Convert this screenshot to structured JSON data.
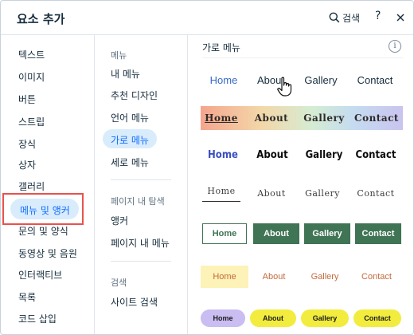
{
  "header": {
    "title": "요소 추가",
    "search_label": "검색",
    "help_label": "?"
  },
  "categories": [
    "텍스트",
    "이미지",
    "버튼",
    "스트립",
    "장식",
    "상자",
    "갤러리",
    "메뉴 및 앵커",
    "문의 및 양식",
    "동영상 및 음원",
    "인터랙티브",
    "목록",
    "코드 삽입"
  ],
  "active_category": "메뉴 및 앵커",
  "subcategories": {
    "group1_title": "메뉴",
    "group1_items": [
      "내 메뉴",
      "추천 디자인",
      "언어 메뉴",
      "가로 메뉴",
      "세로 메뉴"
    ],
    "active_item": "가로 메뉴",
    "group2_title": "페이지 내 탐색",
    "group2_items": [
      "앵커",
      "페이지 내 메뉴"
    ],
    "group3_title": "검색",
    "group3_items": [
      "사이트 검색"
    ]
  },
  "section": {
    "title": "가로 메뉴",
    "info_label": "i"
  },
  "menu_presets": [
    [
      "Home",
      "About",
      "Gallery",
      "Contact"
    ],
    [
      "Home",
      "About",
      "Gallery",
      "Contact"
    ],
    [
      "Home",
      "About",
      "Gallery",
      "Contact"
    ],
    [
      "Home",
      "About",
      "Gallery",
      "Contact"
    ],
    [
      "Home",
      "About",
      "Gallery",
      "Contact"
    ],
    [
      "Home",
      "About",
      "Gallery",
      "Contact"
    ],
    [
      "Home",
      "About",
      "Gallery",
      "Contact"
    ]
  ],
  "colors": {
    "accent": "#116dff",
    "active_bg": "#d9ecfc",
    "highlight_border": "#e8524d",
    "green": "#3f7454",
    "yellow": "#f2ec3f",
    "lavender": "#c9bdf2"
  },
  "icons": [
    "search-icon",
    "help-icon",
    "close-icon",
    "info-icon",
    "hand-cursor-icon"
  ]
}
